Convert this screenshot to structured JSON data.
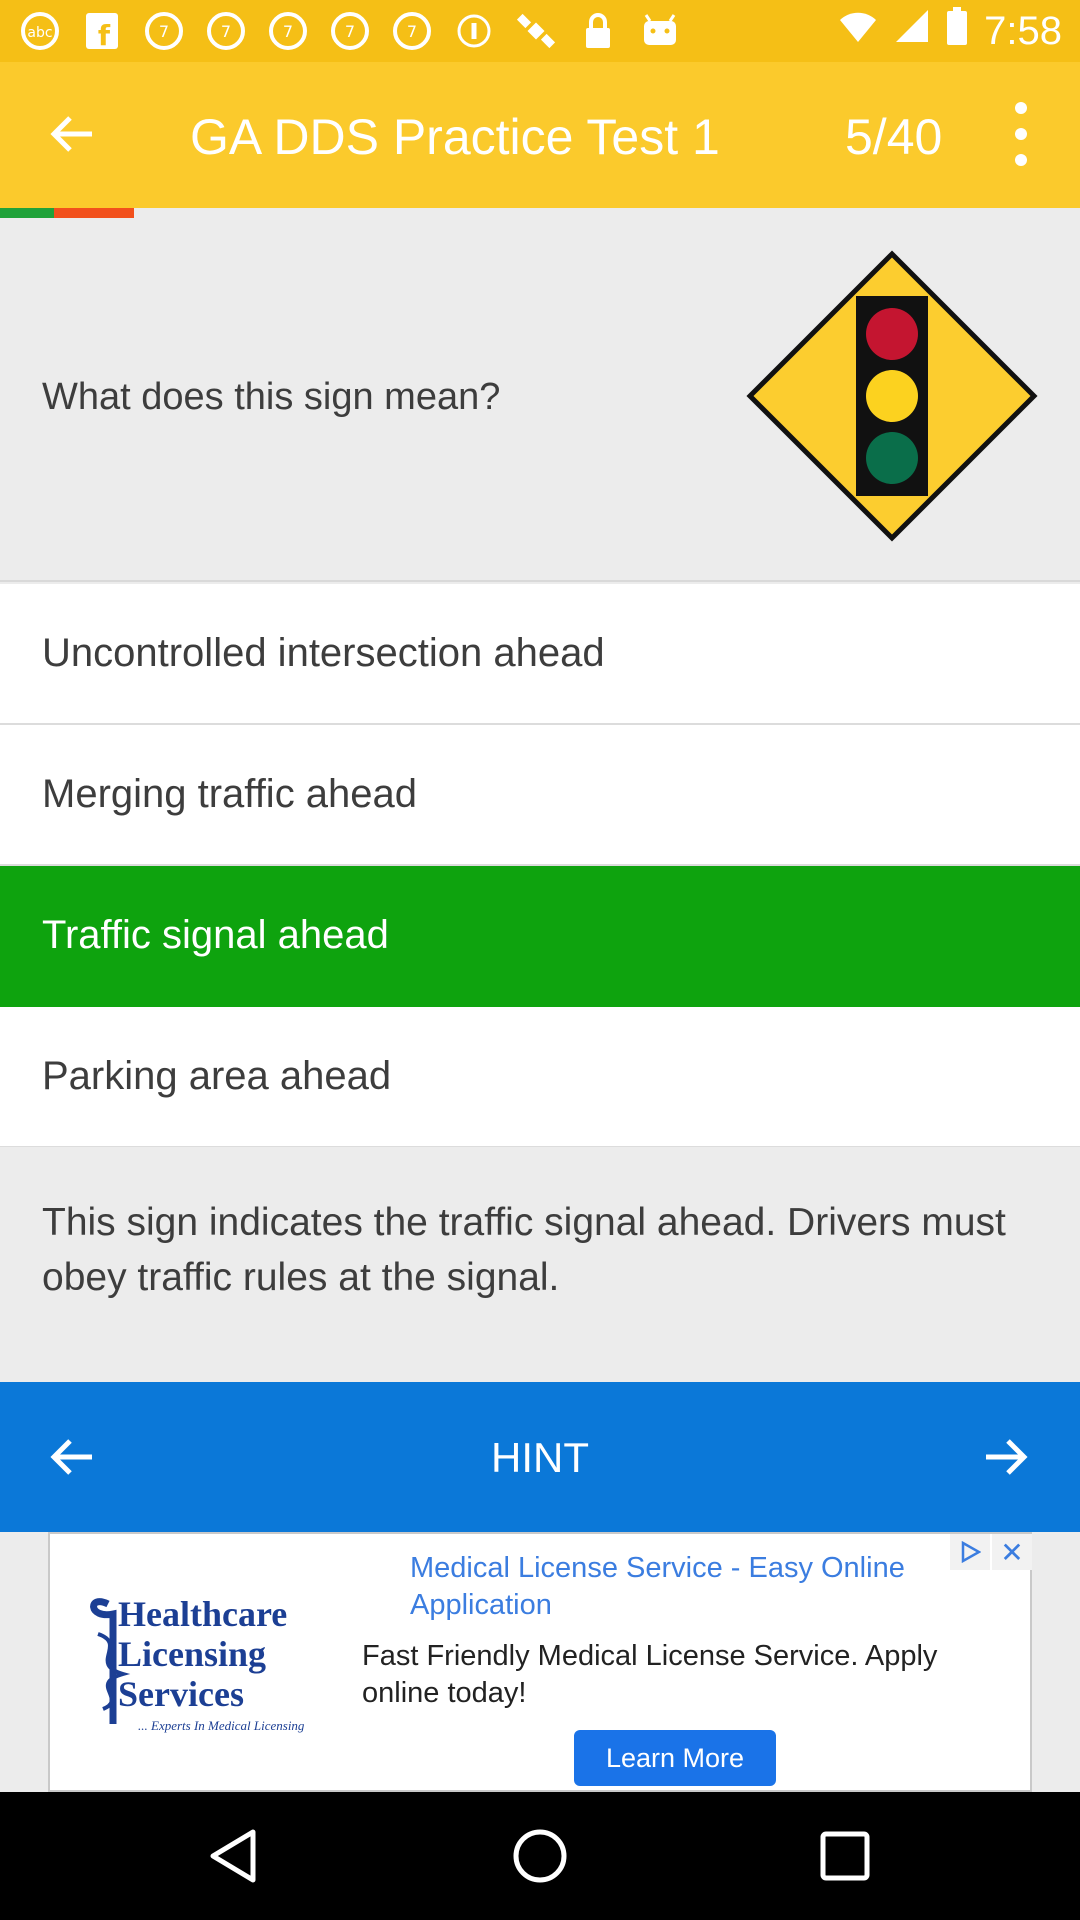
{
  "status_bar": {
    "icons": [
      "abc7-icon",
      "facebook-icon",
      "abc7-icon",
      "abc7-icon",
      "abc7-icon",
      "abc7-icon",
      "abc7-icon",
      "info-icon",
      "satellite-icon",
      "lock-icon",
      "android-icon"
    ],
    "time": "7:58"
  },
  "header": {
    "title": "GA DDS Practice Test 1",
    "counter": "5/40",
    "bg_color": "#fbca2c"
  },
  "progress": {
    "correct_color": "#20a23a",
    "wrong_color": "#f2501c"
  },
  "question": {
    "text": "What does this sign mean?",
    "sign_icon": "traffic-signal-ahead-sign"
  },
  "options": [
    {
      "label": "Uncontrolled intersection ahead",
      "state": "default"
    },
    {
      "label": "Merging traffic ahead",
      "state": "default"
    },
    {
      "label": "Traffic signal ahead",
      "state": "correct"
    },
    {
      "label": "Parking area ahead",
      "state": "default"
    }
  ],
  "explanation": "This sign indicates the traffic signal ahead. Drivers must obey traffic rules at the signal.",
  "bottom_bar": {
    "hint_label": "HINT",
    "bg_color": "#0b78d8"
  },
  "ad": {
    "logo_lines": [
      "Healthcare",
      "Licensing",
      "Services",
      "... Experts In Medical Licensing"
    ],
    "title": "Medical License Service - Easy Online Application",
    "body": "Fast Friendly Medical License Service. Apply online today!",
    "cta": "Learn More"
  }
}
